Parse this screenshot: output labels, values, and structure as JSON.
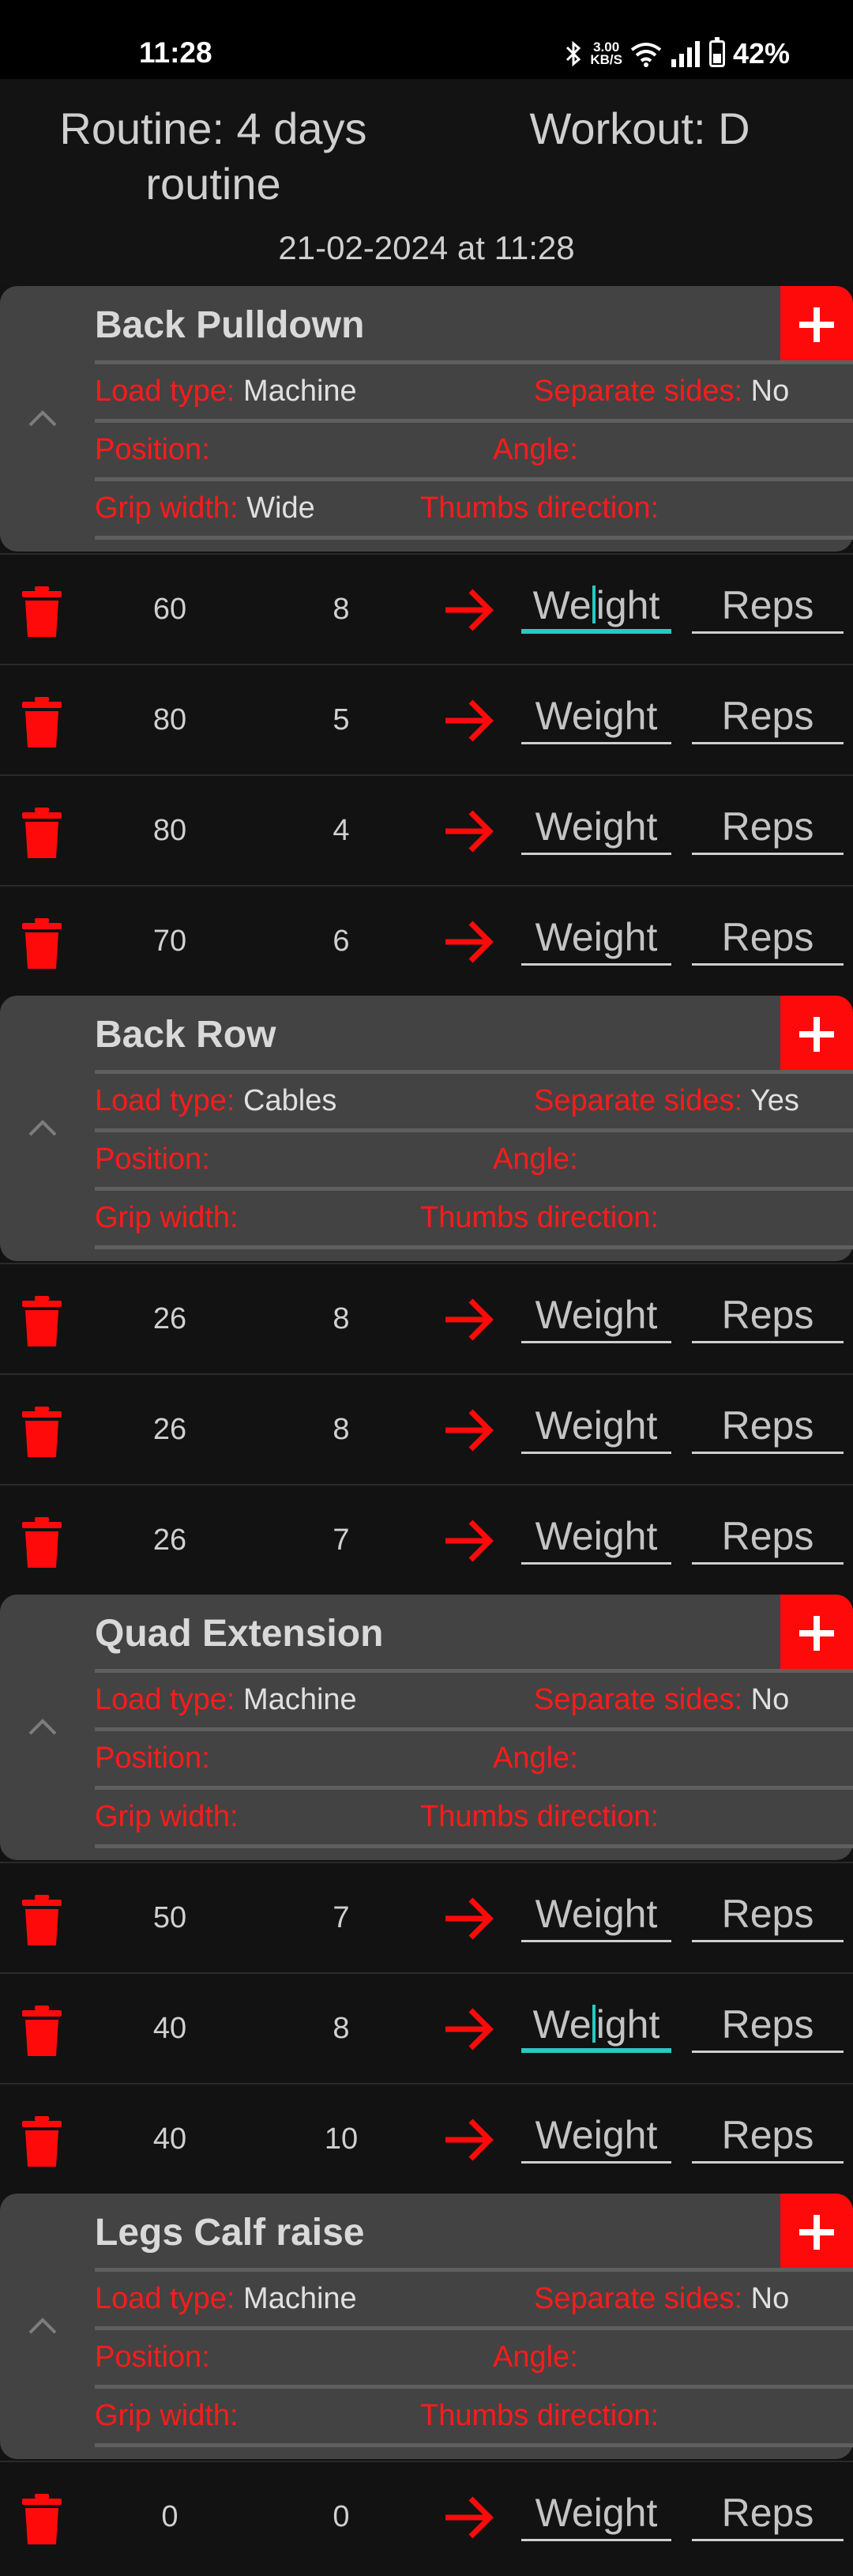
{
  "status_bar": {
    "time": "11:28",
    "net_speed_top": "3.00",
    "net_speed_bottom": "KB/S",
    "battery": "42%"
  },
  "header": {
    "routine": "Routine: 4 days routine",
    "workout": "Workout: D",
    "date": "21-02-2024 at 11:28"
  },
  "labels": {
    "load_type": "Load type:",
    "separate_sides": "Separate sides:",
    "position": "Position:",
    "angle": "Angle:",
    "grip_width": "Grip width:",
    "thumbs_direction": "Thumbs direction:",
    "weight_placeholder": "Weight",
    "reps_placeholder": "Reps"
  },
  "colors": {
    "accent_red": "#ff0a0a",
    "focus_teal": "#29c9c1",
    "card_bg": "#434343",
    "page_bg": "#121212"
  },
  "exercises": [
    {
      "name": "Back Pulldown",
      "load_type": "Machine",
      "separate_sides": "No",
      "position": "",
      "angle": "",
      "grip_width": "Wide",
      "thumbs_direction": "",
      "sets": [
        {
          "weight": "60",
          "reps": "8",
          "focused": true
        },
        {
          "weight": "80",
          "reps": "5"
        },
        {
          "weight": "80",
          "reps": "4"
        },
        {
          "weight": "70",
          "reps": "6"
        }
      ]
    },
    {
      "name": "Back Row",
      "load_type": "Cables",
      "separate_sides": "Yes",
      "position": "",
      "angle": "",
      "grip_width": "",
      "thumbs_direction": "",
      "sets": [
        {
          "weight": "26",
          "reps": "8"
        },
        {
          "weight": "26",
          "reps": "8"
        },
        {
          "weight": "26",
          "reps": "7"
        }
      ]
    },
    {
      "name": "Quad Extension",
      "load_type": "Machine",
      "separate_sides": "No",
      "position": "",
      "angle": "",
      "grip_width": "",
      "thumbs_direction": "",
      "sets": [
        {
          "weight": "50",
          "reps": "7"
        },
        {
          "weight": "40",
          "reps": "8",
          "focused": true
        },
        {
          "weight": "40",
          "reps": "10"
        }
      ]
    },
    {
      "name": "Legs Calf raise",
      "load_type": "Machine",
      "separate_sides": "No",
      "position": "",
      "angle": "",
      "grip_width": "",
      "thumbs_direction": "",
      "sets": [
        {
          "weight": "0",
          "reps": "0"
        }
      ]
    }
  ]
}
